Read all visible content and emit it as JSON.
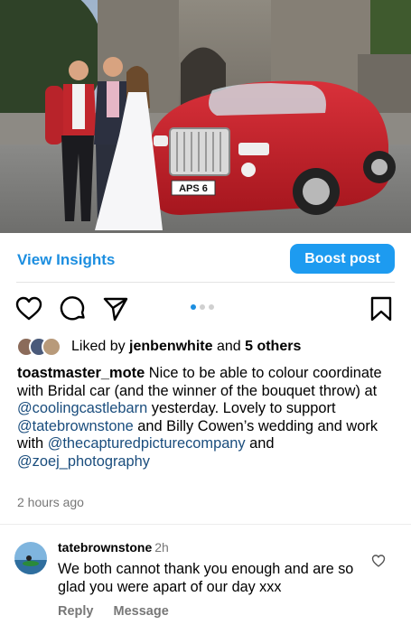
{
  "photo": {
    "plate": "APS 6"
  },
  "insights": {
    "view_label": "View Insights",
    "boost_label": "Boost post"
  },
  "carousel": {
    "count": 3,
    "active": 1
  },
  "likes": {
    "prefix": "Liked by ",
    "user": "jenbenwhite",
    "middle": " and ",
    "others": "5 others"
  },
  "caption": {
    "username": "toastmaster_mote",
    "t1": " Nice to be able to colour coordinate with Bridal car (and the winner of the bouquet throw) at ",
    "m1": "@coolingcastlebarn",
    "t2": " yesterday. Lovely to support ",
    "m2": "@tatebrownstone",
    "t3": " and Billy Cowen’s wedding and work with ",
    "m3": "@thecapturedpicturecompany",
    "t4": " and ",
    "m4": "@zoej_photography"
  },
  "time_ago": "2 hours ago",
  "comment": {
    "username": "tatebrownstone",
    "time": "2h",
    "text": "We both cannot thank you enough and are so glad you were apart of our day xxx",
    "reply_label": "Reply",
    "message_label": "Message"
  },
  "colors": {
    "link": "#1c8ee0",
    "boost": "#1d9bf0",
    "mention": "#1a4d7d",
    "car": "#c8202a"
  }
}
